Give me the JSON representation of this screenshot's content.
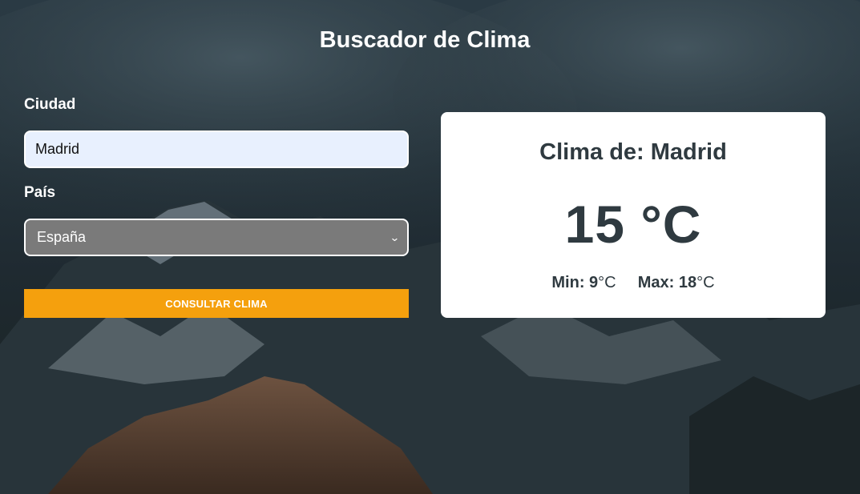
{
  "page": {
    "title": "Buscador de Clima"
  },
  "form": {
    "city_label": "Ciudad",
    "city_value": "Madrid",
    "country_label": "País",
    "country_selected": "España",
    "submit_label": "CONSULTAR CLIMA"
  },
  "result": {
    "heading": "Clima de: Madrid",
    "temperature": "15 °C",
    "min_label": "Min:",
    "min_value": "9",
    "max_label": "Max:",
    "max_value": "18",
    "unit": "°C"
  },
  "colors": {
    "accent": "#f5a00d",
    "card_bg": "#ffffff",
    "input_bg": "#e8f0fe",
    "select_bg": "#7a7a7a",
    "text_dark": "#2f3a40"
  },
  "icons": {
    "select_arrow": "chevron-down-icon"
  }
}
